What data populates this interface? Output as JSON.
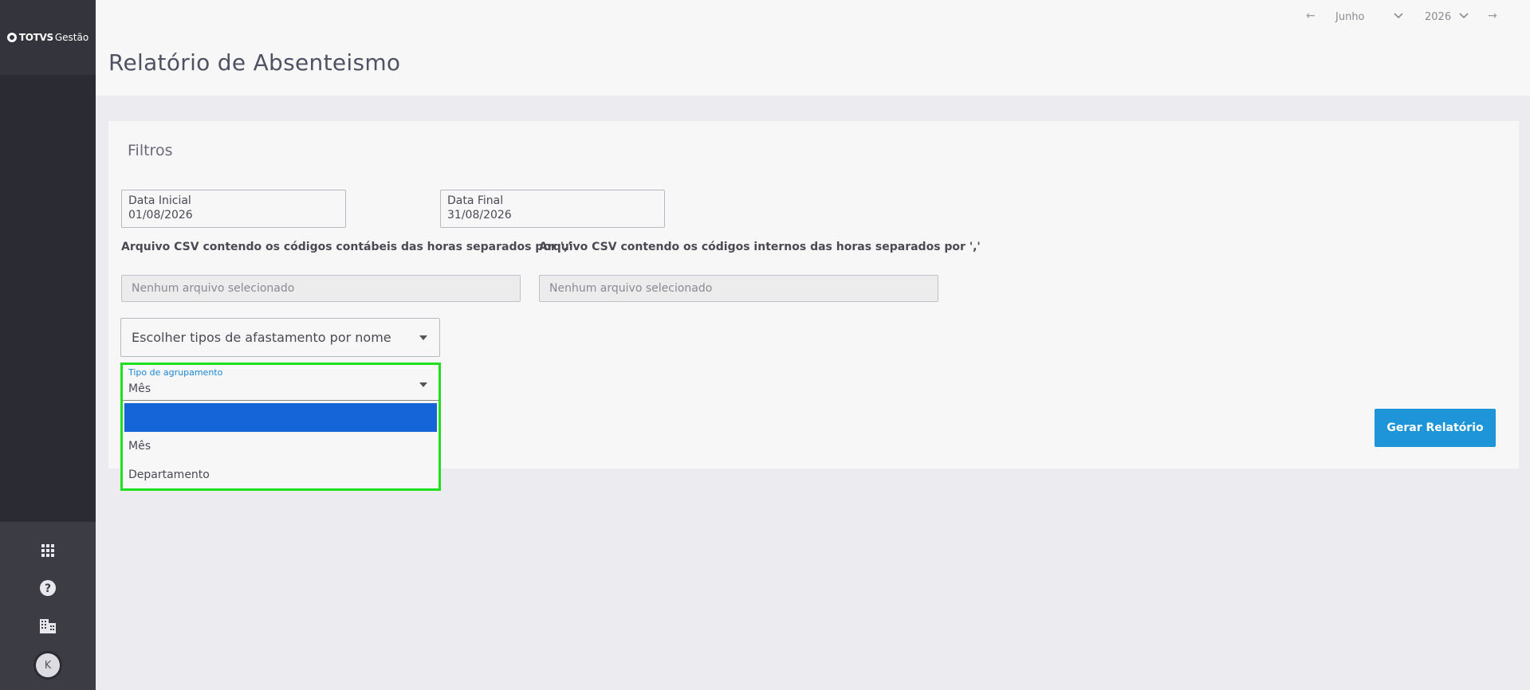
{
  "app": {
    "brand": "TOTVS",
    "product": "Gestão"
  },
  "sidebar": {
    "icons": [
      "apps-grid-icon",
      "help-icon",
      "building-icon"
    ],
    "avatar_initial": "K"
  },
  "period": {
    "month": "Junho",
    "year": "2026"
  },
  "page": {
    "title": "Relatório de Absenteismo"
  },
  "filters": {
    "title": "Filtros",
    "date_start": {
      "label": "Data Inicial",
      "value": "01/08/2026"
    },
    "date_end": {
      "label": "Data Final",
      "value": "31/08/2026"
    },
    "csv_accounting": {
      "label": "Arquivo CSV contendo os códigos contábeis das horas separados por ','",
      "placeholder": "Nenhum arquivo selecionado"
    },
    "csv_internal": {
      "label": "Arquivo CSV contendo os códigos internos das horas separados por ','",
      "placeholder": "Nenhum arquivo selecionado"
    },
    "absence_types": {
      "placeholder": "Escolher tipos de afastamento por nome"
    },
    "grouping": {
      "label": "Tipo de agrupamento",
      "value": "Mês",
      "options": [
        "",
        "Mês",
        "Departamento"
      ]
    }
  },
  "actions": {
    "generate": "Gerar Relatório"
  },
  "colors": {
    "sidebar": "#2b2b33",
    "primary": "#1d95d8",
    "highlight": "#1ee11e",
    "selected_option": "#1565d8"
  }
}
